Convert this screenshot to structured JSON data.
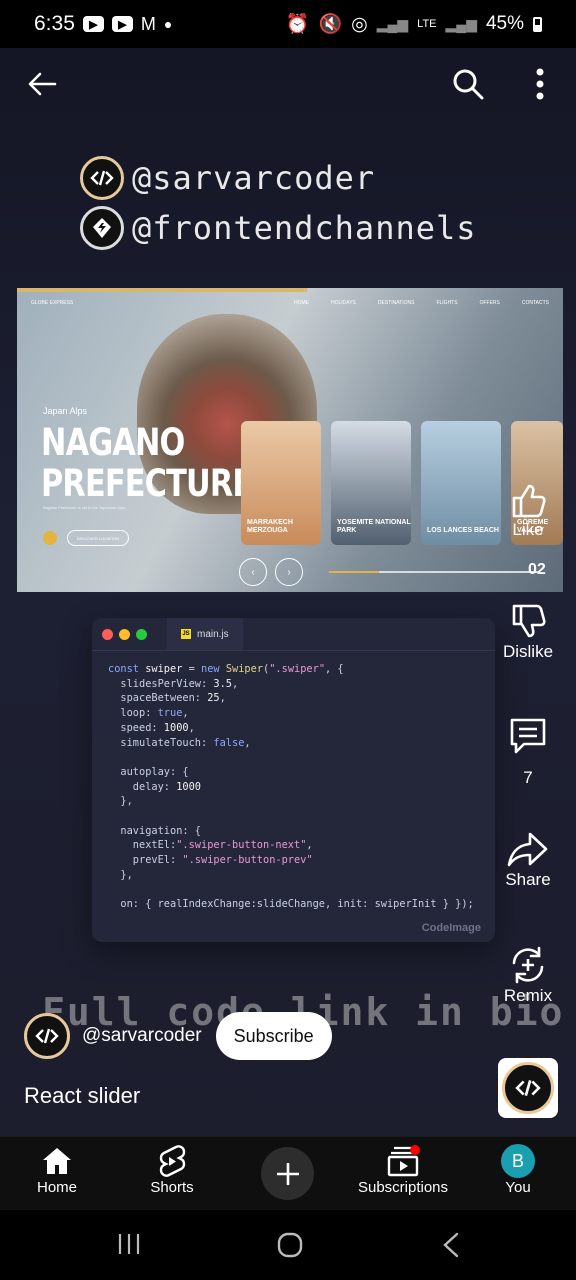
{
  "status_bar": {
    "time": "6:35",
    "battery": "45%",
    "network": "LTE"
  },
  "channel_handles": [
    "@sarvarcoder",
    "@frontendchannels"
  ],
  "hero": {
    "brand": "GLOBE EXPRESS",
    "nav_links": [
      "HOME",
      "HOLIDAYS",
      "DESTINATIONS",
      "FLIGHTS",
      "OFFERS",
      "CONTACTS"
    ],
    "tag": "Japan Alps",
    "title_line1": "NAGANO",
    "title_line2": "PREFECTURE",
    "description": "Nagano Prefecture is set in the Japanese Alps...",
    "button_label": "DISCOVER LOCATION",
    "cards": [
      {
        "label": "MARRAKECH MERZOUGA",
        "color": "#d8a26e"
      },
      {
        "label": "YOSEMITE NATIONAL PARK",
        "color": "#5c7082"
      },
      {
        "label": "LOS LANCES BEACH",
        "color": "#7fa0b5"
      },
      {
        "label": "GÖREME VALLEY",
        "color": "#c7a27a"
      }
    ],
    "slide_counter": "02"
  },
  "code_window": {
    "file_name": "main.js",
    "footer": "CodeImage"
  },
  "actions": {
    "like_label": "Like",
    "dislike_label": "Dislike",
    "comment_count": "7",
    "share_label": "Share",
    "remix_label": "Remix"
  },
  "overlay_text": "Full code link in bio",
  "channel": {
    "name": "@sarvarcoder",
    "subscribe_label": "Subscribe"
  },
  "video_title": "React slider",
  "bottom_nav": {
    "home": "Home",
    "shorts": "Shorts",
    "subscriptions": "Subscriptions",
    "you": "You",
    "you_initial": "B"
  },
  "colors": {
    "accent_red": "#ff0000",
    "avatar_bg": "#1a9fb0",
    "hero_accent": "#e3b440"
  }
}
